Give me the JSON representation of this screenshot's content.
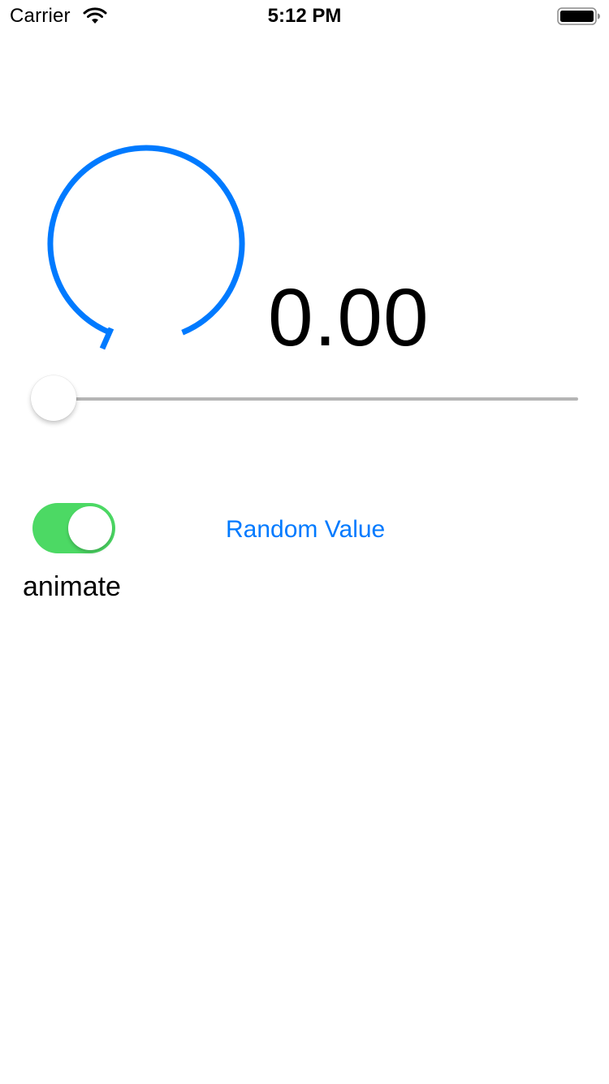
{
  "status_bar": {
    "carrier": "Carrier",
    "time": "5:12 PM",
    "wifi_icon": "wifi-icon",
    "battery_icon": "battery-icon"
  },
  "gauge": {
    "value": 0.0,
    "display": "0.00",
    "color": "#007aff"
  },
  "slider": {
    "value": 0.0,
    "min": 0,
    "max": 1
  },
  "animate": {
    "label": "animate",
    "on": true,
    "on_color": "#4cd964"
  },
  "actions": {
    "random_label": "Random Value",
    "accent_color": "#007aff"
  }
}
